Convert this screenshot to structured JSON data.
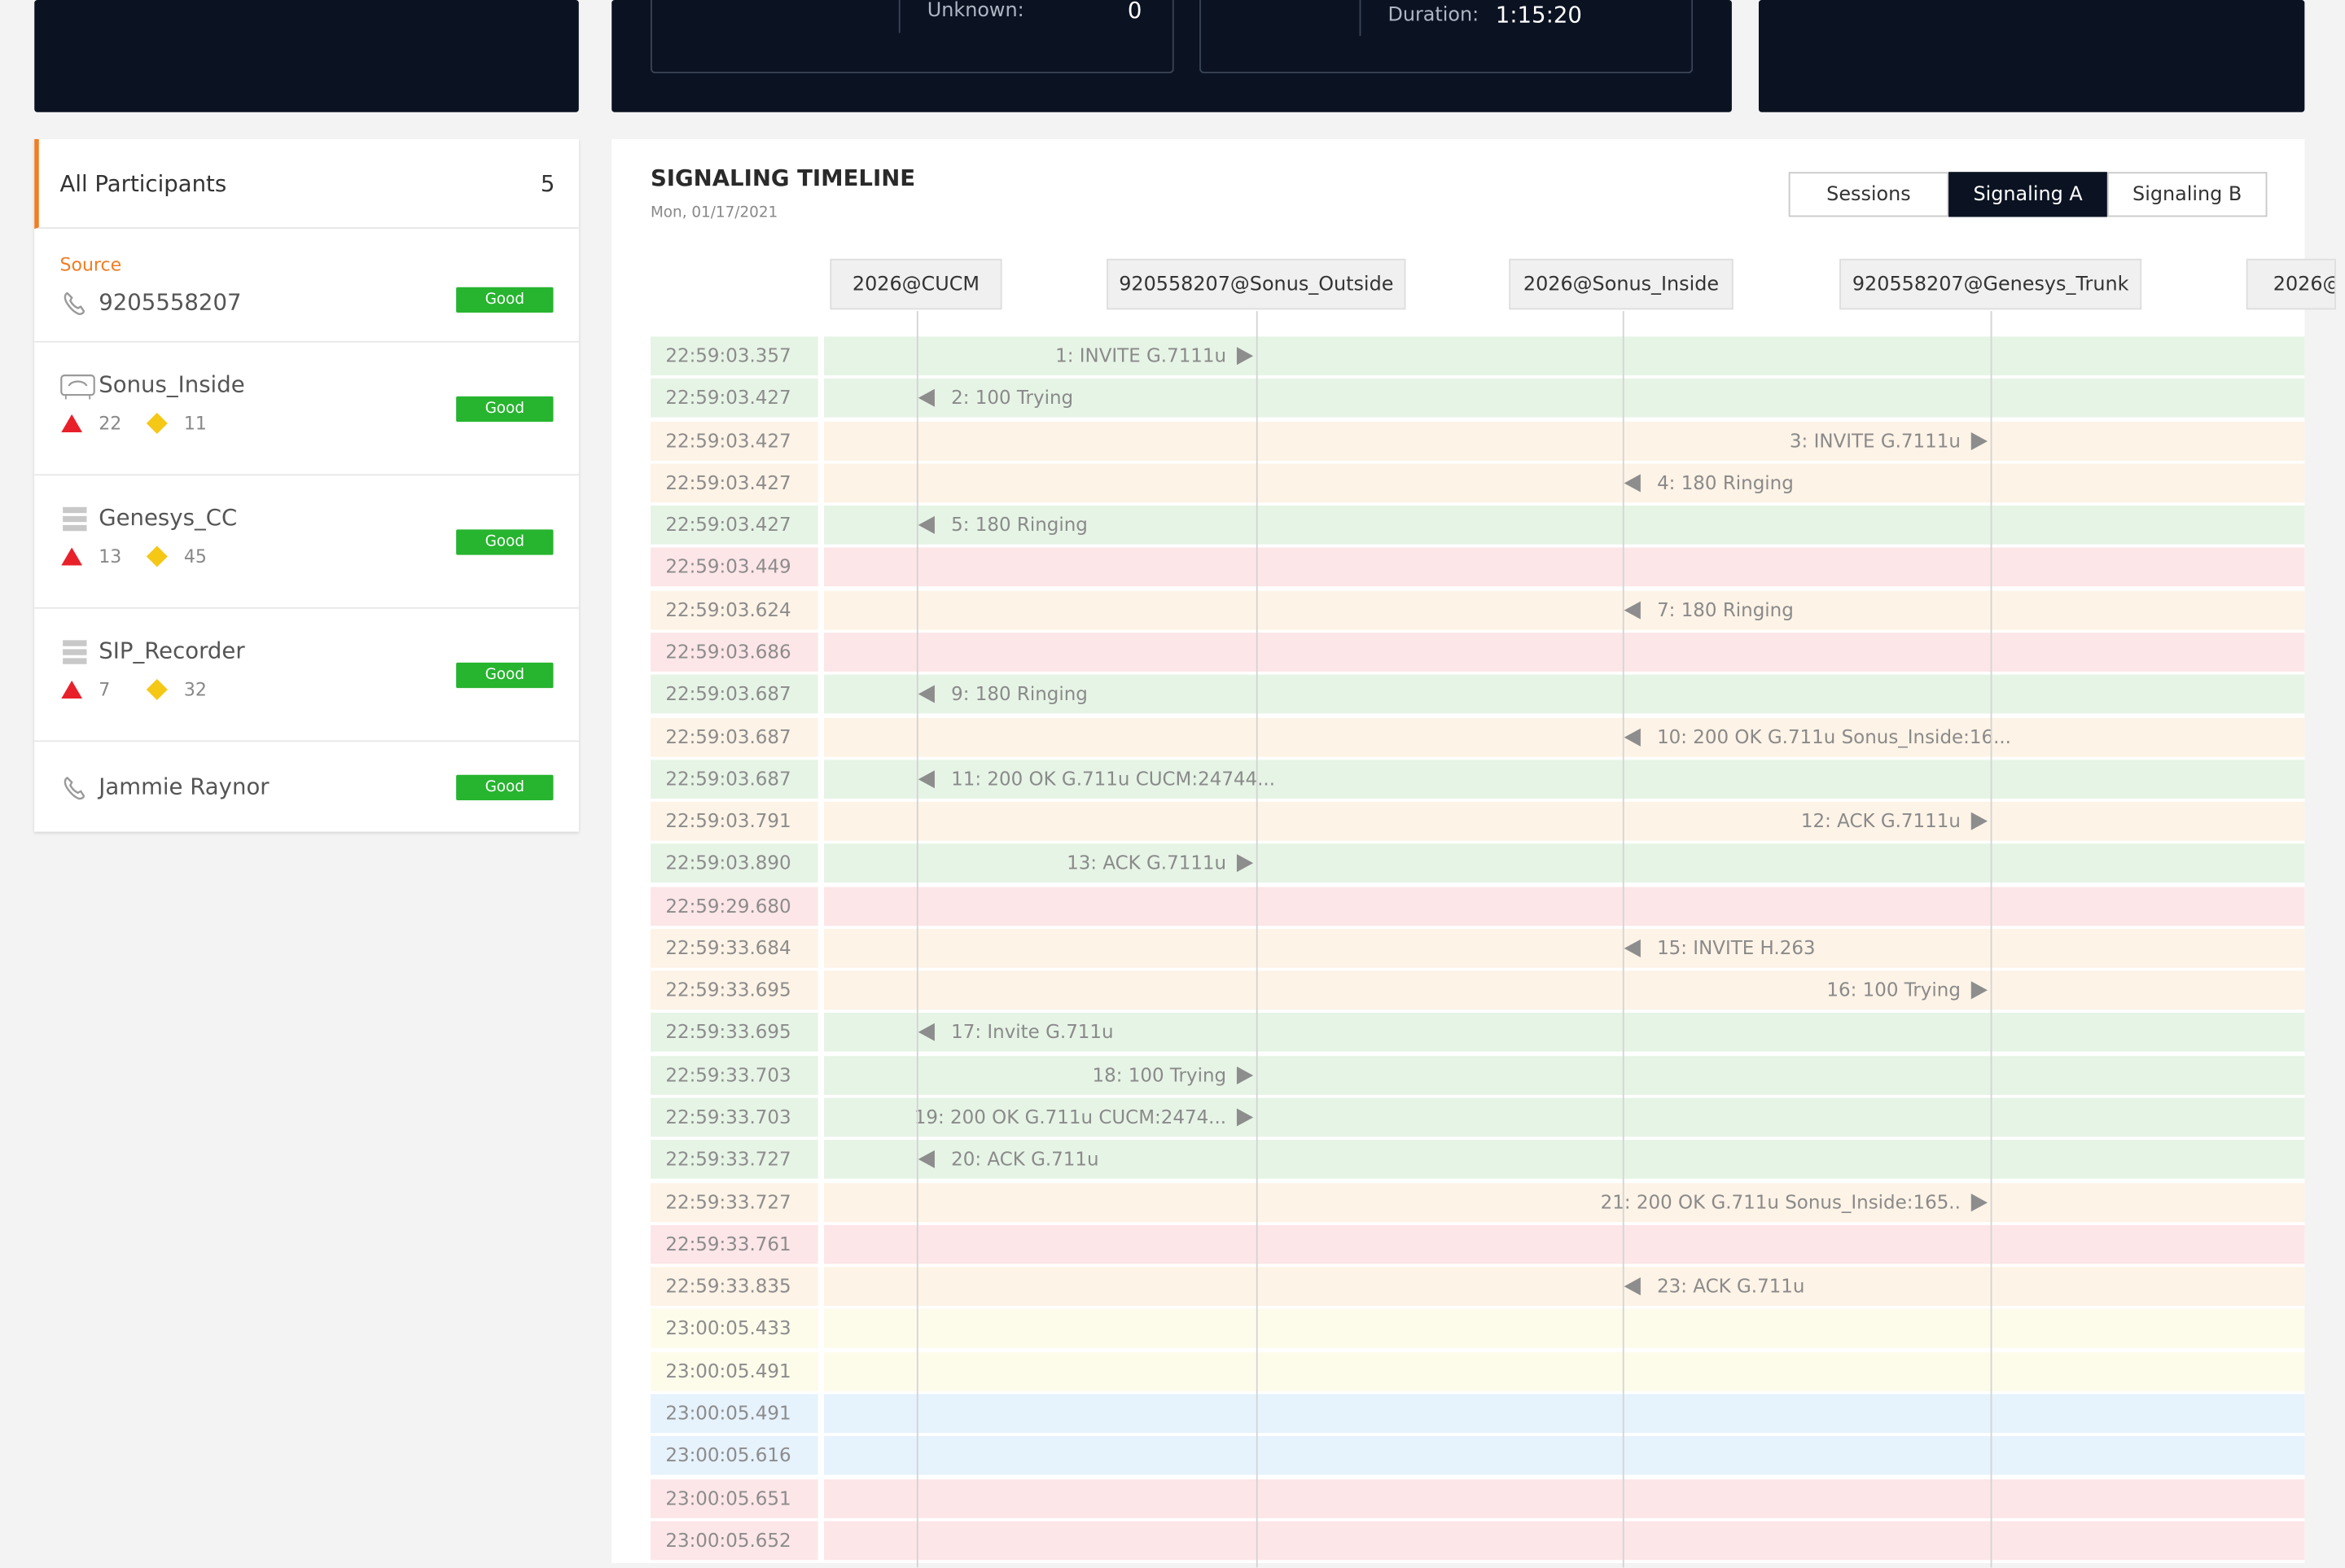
{
  "stats": {
    "unknown_label": "Unknown:",
    "unknown_value": "0",
    "duration_label": "Duration:",
    "duration_value": "1:15:20"
  },
  "participants": {
    "header_label": "All Participants",
    "header_count": "5",
    "source_label": "Source",
    "items": [
      {
        "name": "9205558207",
        "status": "Good",
        "icon": "phone-icon"
      },
      {
        "name": "Sonus_Inside",
        "status": "Good",
        "icon": "gateway-icon",
        "errors": "22",
        "warnings": "11"
      },
      {
        "name": "Genesys_CC",
        "status": "Good",
        "icon": "server-icon",
        "errors": "13",
        "warnings": "45"
      },
      {
        "name": "SIP_Recorder",
        "status": "Good",
        "icon": "server-icon",
        "errors": "7",
        "warnings": "32"
      },
      {
        "name": "Jammie Raynor",
        "status": "Good",
        "icon": "phone-icon"
      }
    ],
    "colors": {
      "good": "#27b42f",
      "error": "#e8202a",
      "warning": "#f5c816",
      "accent": "#f07d23"
    }
  },
  "timeline": {
    "title": "SIGNALING TIMELINE",
    "date": "Mon, 01/17/2021",
    "tabs": [
      "Sessions",
      "Signaling A",
      "Signaling B"
    ],
    "active_tab": "Signaling A",
    "columns": [
      "2026@CUCM",
      "920558207@Sonus_Outside",
      "2026@Sonus_Inside",
      "920558207@Genesys_Trunk",
      "2026@"
    ],
    "row_colors": {
      "green": "#e6f4e6",
      "orange": "#fdf3e6",
      "red": "#fde6e8",
      "yellow": "#fdfbea",
      "blue": "#e6f2fc"
    },
    "rows": [
      {
        "time": "22:59:03.357",
        "color": "green",
        "label": "1: INVITE G.7111u",
        "from": 0,
        "to": 1
      },
      {
        "time": "22:59:03.427",
        "color": "green",
        "label": "2: 100 Trying",
        "from": 1,
        "to": 0
      },
      {
        "time": "22:59:03.427",
        "color": "orange",
        "label": "3: INVITE G.7111u",
        "from": 2,
        "to": 3
      },
      {
        "time": "22:59:03.427",
        "color": "orange",
        "label": "4: 180 Ringing",
        "from": 3,
        "to": 2
      },
      {
        "time": "22:59:03.427",
        "color": "green",
        "label": "5: 180 Ringing",
        "from": 1,
        "to": 0
      },
      {
        "time": "22:59:03.449",
        "color": "red",
        "label": "",
        "from": null,
        "to": null
      },
      {
        "time": "22:59:03.624",
        "color": "orange",
        "label": "7: 180 Ringing",
        "from": 3,
        "to": 2
      },
      {
        "time": "22:59:03.686",
        "color": "red",
        "label": "",
        "from": null,
        "to": null
      },
      {
        "time": "22:59:03.687",
        "color": "green",
        "label": "9: 180 Ringing",
        "from": 1,
        "to": 0
      },
      {
        "time": "22:59:03.687",
        "color": "orange",
        "label": "10: 200 OK G.711u Sonus_Inside:16...",
        "from": 3,
        "to": 2
      },
      {
        "time": "22:59:03.687",
        "color": "green",
        "label": "11: 200 OK G.711u CUCM:24744...",
        "from": 1,
        "to": 0
      },
      {
        "time": "22:59:03.791",
        "color": "orange",
        "label": "12: ACK G.7111u",
        "from": 2,
        "to": 3
      },
      {
        "time": "22:59:03.890",
        "color": "green",
        "label": "13: ACK G.7111u",
        "from": 0,
        "to": 1
      },
      {
        "time": "22:59:29.680",
        "color": "red",
        "label": "",
        "from": null,
        "to": null
      },
      {
        "time": "22:59:33.684",
        "color": "orange",
        "label": "15: INVITE H.263",
        "from": 3,
        "to": 2
      },
      {
        "time": "22:59:33.695",
        "color": "orange",
        "label": "16: 100 Trying",
        "from": 2,
        "to": 3
      },
      {
        "time": "22:59:33.695",
        "color": "green",
        "label": "17: Invite G.711u",
        "from": 1,
        "to": 0
      },
      {
        "time": "22:59:33.703",
        "color": "green",
        "label": "18:  100 Trying",
        "from": 0,
        "to": 1
      },
      {
        "time": "22:59:33.703",
        "color": "green",
        "label": "19:  200 OK G.711u CUCM:2474...",
        "from": 0,
        "to": 1
      },
      {
        "time": "22:59:33.727",
        "color": "green",
        "label": "20: ACK G.711u",
        "from": 1,
        "to": 0
      },
      {
        "time": "22:59:33.727",
        "color": "orange",
        "label": "21: 200 OK G.711u Sonus_Inside:165..",
        "from": 2,
        "to": 3
      },
      {
        "time": "22:59:33.761",
        "color": "red",
        "label": "",
        "from": null,
        "to": null
      },
      {
        "time": "22:59:33.835",
        "color": "orange",
        "label": "23: ACK G.711u",
        "from": 3,
        "to": 2
      },
      {
        "time": "23:00:05.433",
        "color": "yellow",
        "label": "",
        "from": null,
        "to": null
      },
      {
        "time": "23:00:05.491",
        "color": "yellow",
        "label": "",
        "from": null,
        "to": null
      },
      {
        "time": "23:00:05.491",
        "color": "blue",
        "label": "",
        "from": null,
        "to": null
      },
      {
        "time": "23:00:05.616",
        "color": "blue",
        "label": "",
        "from": null,
        "to": null
      },
      {
        "time": "23:00:05.651",
        "color": "red",
        "label": "",
        "from": null,
        "to": null
      },
      {
        "time": "23:00:05.652",
        "color": "red",
        "label": "",
        "from": null,
        "to": null
      }
    ]
  }
}
